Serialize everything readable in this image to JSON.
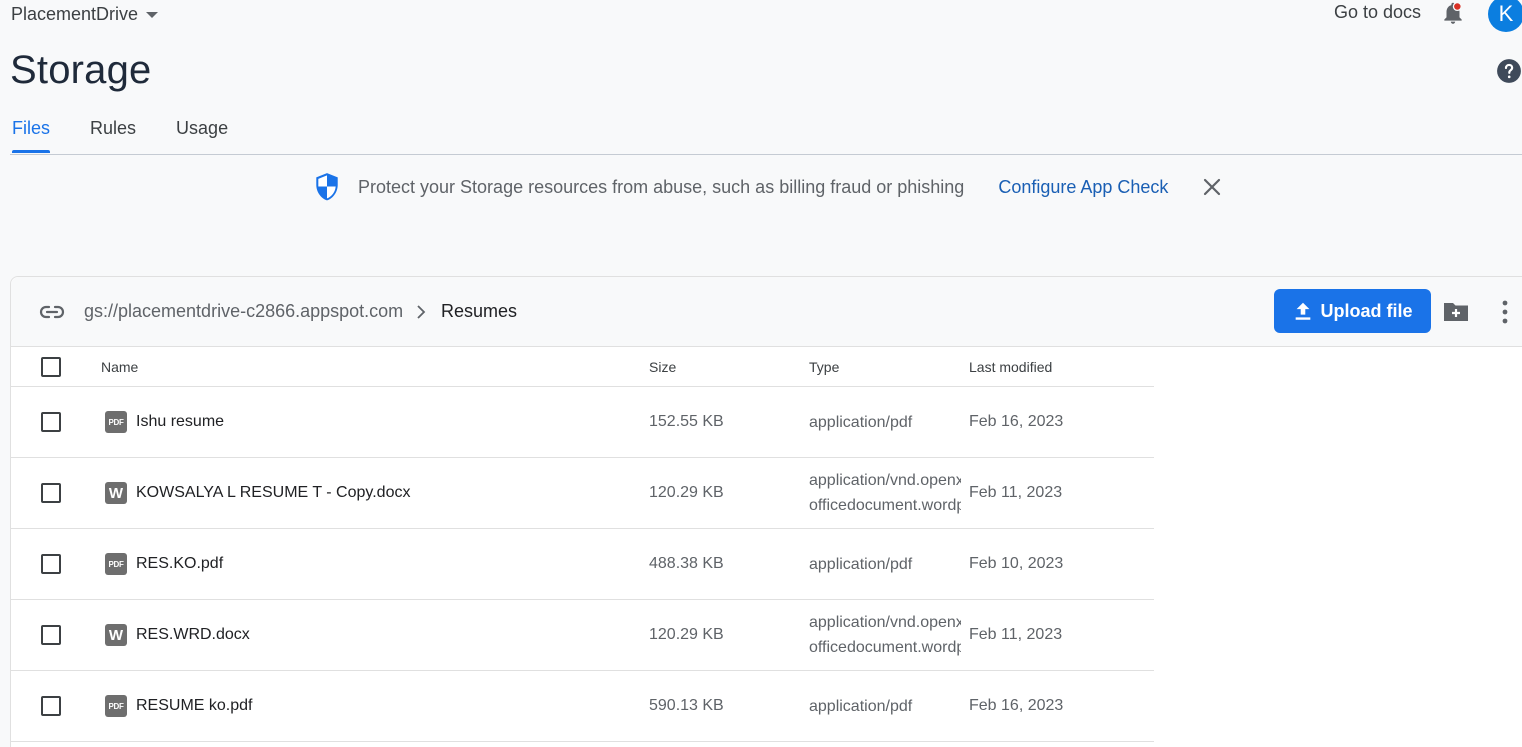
{
  "topbar": {
    "project_name": "PlacementDrive",
    "docs_link": "Go to docs",
    "avatar_initial": "K"
  },
  "page": {
    "title": "Storage"
  },
  "tabs": [
    {
      "label": "Files",
      "active": true
    },
    {
      "label": "Rules",
      "active": false
    },
    {
      "label": "Usage",
      "active": false
    }
  ],
  "banner": {
    "text": "Protect your Storage resources from abuse, such as billing fraud or phishing",
    "link": "Configure App Check"
  },
  "toolbar": {
    "bucket": "gs://placementdrive-c2866.appspot.com",
    "folder": "Resumes",
    "upload_label": "Upload file"
  },
  "table": {
    "headers": {
      "name": "Name",
      "size": "Size",
      "type": "Type",
      "modified": "Last modified"
    },
    "rows": [
      {
        "icon": "PDF",
        "name": "Ishu resume",
        "size": "152.55 KB",
        "type": "application/pdf",
        "type2": "",
        "modified": "Feb 16, 2023"
      },
      {
        "icon": "W",
        "name": "KOWSALYA L RESUME T - Copy.docx",
        "size": "120.29 KB",
        "type": "application/vnd.openxmlformats-",
        "type2": "officedocument.wordprocessingml.document",
        "modified": "Feb 11, 2023"
      },
      {
        "icon": "PDF",
        "name": "RES.KO.pdf",
        "size": "488.38 KB",
        "type": "application/pdf",
        "type2": "",
        "modified": "Feb 10, 2023"
      },
      {
        "icon": "W",
        "name": "RES.WRD.docx",
        "size": "120.29 KB",
        "type": "application/vnd.openxmlformats-",
        "type2": "officedocument.wordprocessingml.document",
        "modified": "Feb 11, 2023"
      },
      {
        "icon": "PDF",
        "name": "RESUME ko.pdf",
        "size": "590.13 KB",
        "type": "application/pdf",
        "type2": "",
        "modified": "Feb 16, 2023"
      }
    ]
  },
  "colors": {
    "accent": "#1a73e8",
    "link": "#1a5fb4",
    "shield": "#1a73e8",
    "notification_dot": "#d93025"
  }
}
